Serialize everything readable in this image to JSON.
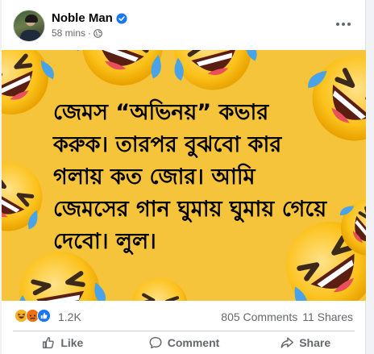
{
  "post": {
    "author": "Noble Man",
    "time": "58 mins",
    "separator": "·",
    "text": "জেমস “অভিনয়” কভার করুক। তারপর বুঝবো কার গলায় কত জোর। আমি জেমসের গান ঘুমায় ঘুমায় গেয়ে দেবো। লুল।"
  },
  "stats": {
    "reaction_count": "1.2K",
    "comments": "805 Comments",
    "shares": "11 Shares"
  },
  "actions": {
    "like": "Like",
    "comment": "Comment",
    "share": "Share"
  },
  "colors": {
    "background_yellow": "#f6c43a",
    "verified_blue": "#1877f2",
    "muted_text": "#65676b"
  },
  "icons": [
    "verified-badge-icon",
    "globe-icon",
    "more-options-icon",
    "haha-reaction-icon",
    "angry-reaction-icon",
    "like-reaction-icon",
    "like-icon",
    "comment-icon",
    "share-icon",
    "laughing-emoji-icon"
  ]
}
